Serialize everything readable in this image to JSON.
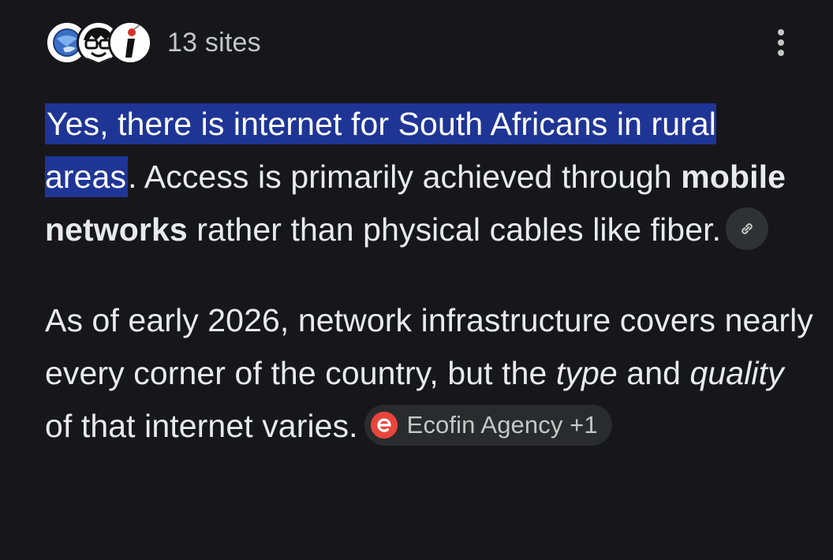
{
  "header": {
    "sites_count": "13 sites",
    "favicons": [
      "globe-favicon-icon",
      "cartoon-face-favicon-icon",
      "info-pin-favicon-icon"
    ],
    "more_icon": "more-vertical-icon"
  },
  "answer": {
    "p1": {
      "highlight": "Yes, there is internet for South Africans in rural areas",
      "after_highlight": ". Access is primarily achieved through ",
      "bold": "mobile networks",
      "rest": " rather than physical cables like fiber.",
      "link_icon": "link-icon"
    },
    "p2": {
      "text1": "As of early 2026, network infrastructure covers nearly every corner of the country, but the ",
      "italic1": "type",
      "text2": " and ",
      "italic2": "quality",
      "text3": " of that internet varies.",
      "source": {
        "label": "Ecofin Agency +1",
        "icon": "ecofin-e-icon",
        "icon_color": "#e8453c"
      }
    }
  },
  "colors": {
    "background": "#17171b",
    "text": "#e8eaed",
    "highlight": "#1f3596",
    "chip": "#303134"
  }
}
